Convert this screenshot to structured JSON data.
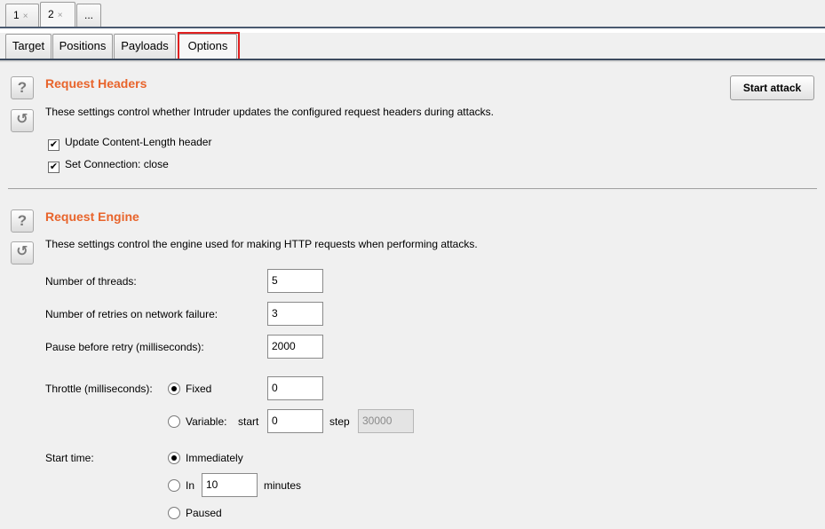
{
  "attack_tabs": [
    {
      "label": "1",
      "close": "×"
    },
    {
      "label": "2",
      "close": "×"
    },
    {
      "label": "..."
    }
  ],
  "sub_tabs": [
    {
      "label": "Target"
    },
    {
      "label": "Positions"
    },
    {
      "label": "Payloads"
    },
    {
      "label": "Options"
    }
  ],
  "active_sub_tab": "Options",
  "start_attack_label": "Start attack",
  "icons": {
    "help": "?",
    "reset": "↺"
  },
  "request_headers": {
    "title": "Request Headers",
    "description": "These settings control whether Intruder updates the configured request headers during attacks.",
    "options": [
      {
        "label": "Update Content-Length header",
        "checked": true,
        "mark": "✔"
      },
      {
        "label": "Set Connection: close",
        "checked": true,
        "mark": "✔"
      }
    ]
  },
  "request_engine": {
    "title": "Request Engine",
    "description": "These settings control the engine used for making HTTP requests when performing attacks.",
    "threads_label": "Number of threads:",
    "threads_value": "5",
    "retries_label": "Number of retries on network failure:",
    "retries_value": "3",
    "pause_label": "Pause before retry (milliseconds):",
    "pause_value": "2000",
    "throttle_label": "Throttle (milliseconds):",
    "throttle_fixed_label": "Fixed",
    "throttle_fixed_value": "0",
    "throttle_variable_label": "Variable:",
    "throttle_start_label": "start",
    "throttle_start_value": "0",
    "throttle_step_label": "step",
    "throttle_step_value": "30000",
    "throttle_selected": "Fixed",
    "start_time_label": "Start time:",
    "start_immediately_label": "Immediately",
    "start_in_label": "In",
    "start_in_value": "10",
    "start_minutes_label": "minutes",
    "start_paused_label": "Paused",
    "start_time_selected": "Immediately"
  },
  "colors": {
    "section_title": "#e8642b",
    "tab_highlight": "#e02020",
    "tab_line": "#3c4a5e"
  }
}
